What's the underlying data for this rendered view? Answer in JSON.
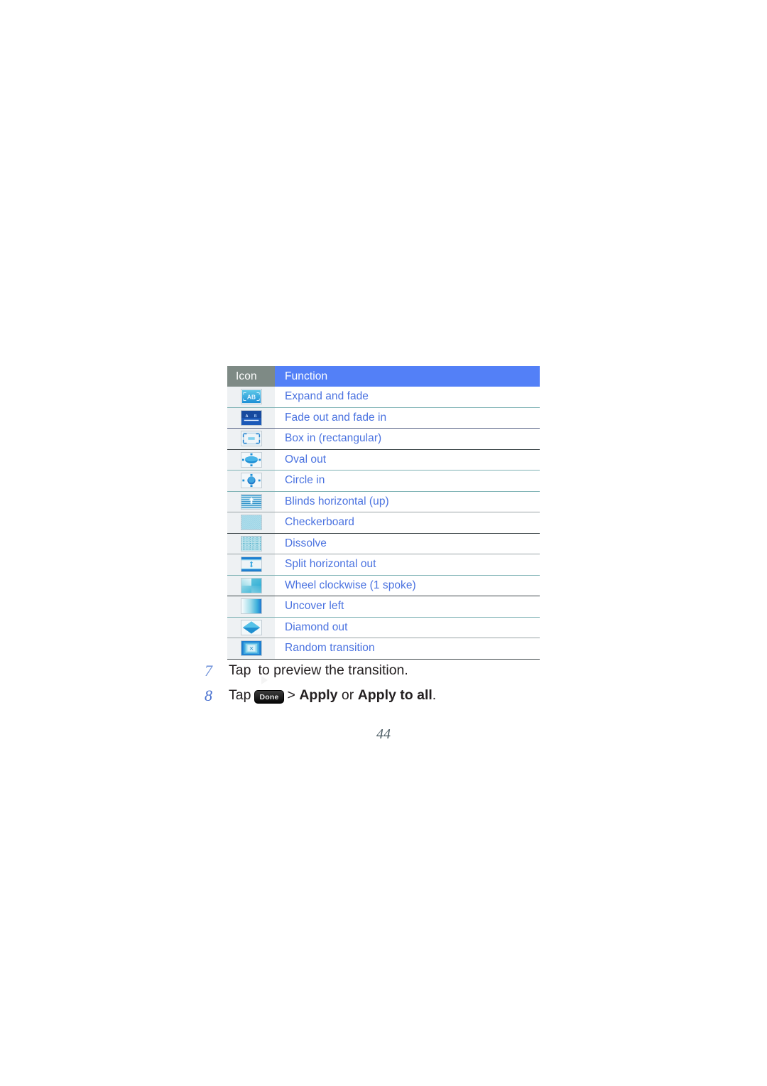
{
  "table": {
    "headers": {
      "icon": "Icon",
      "function": "Function"
    },
    "header_icon_bg": "#7e8a85",
    "header_function_bg": "#5380f7",
    "text_color": "#4a72e0",
    "rows": [
      {
        "icon_name": "expand-and-fade-icon",
        "function": "Expand and fade"
      },
      {
        "icon_name": "fade-out-and-fade-in-icon",
        "function": "Fade out and fade in"
      },
      {
        "icon_name": "box-in-rectangular-icon",
        "function": "Box in (rectangular)"
      },
      {
        "icon_name": "oval-out-icon",
        "function": "Oval out"
      },
      {
        "icon_name": "circle-in-icon",
        "function": "Circle in"
      },
      {
        "icon_name": "blinds-horizontal-up-icon",
        "function": "Blinds horizontal (up)"
      },
      {
        "icon_name": "checkerboard-icon",
        "function": "Checkerboard"
      },
      {
        "icon_name": "dissolve-icon",
        "function": "Dissolve"
      },
      {
        "icon_name": "split-horizontal-out-icon",
        "function": "Split horizontal out"
      },
      {
        "icon_name": "wheel-clockwise-1-spoke-icon",
        "function": "Wheel clockwise (1 spoke)"
      },
      {
        "icon_name": "uncover-left-icon",
        "function": "Uncover left"
      },
      {
        "icon_name": "diamond-out-icon",
        "function": "Diamond out"
      },
      {
        "icon_name": "random-transition-icon",
        "function": "Random transition"
      }
    ]
  },
  "steps": [
    {
      "number": "7",
      "text_before": "Tap",
      "icon_name": "play-icon",
      "text_after": "to preview the transition."
    },
    {
      "number": "8",
      "text_before": "Tap",
      "icon_name": "done-button-icon",
      "icon_label": "Done",
      "separator": ">",
      "apply_label": "Apply",
      "or_label": "or",
      "apply_all_label": "Apply to all",
      "period": "."
    }
  ],
  "page_number": "44"
}
